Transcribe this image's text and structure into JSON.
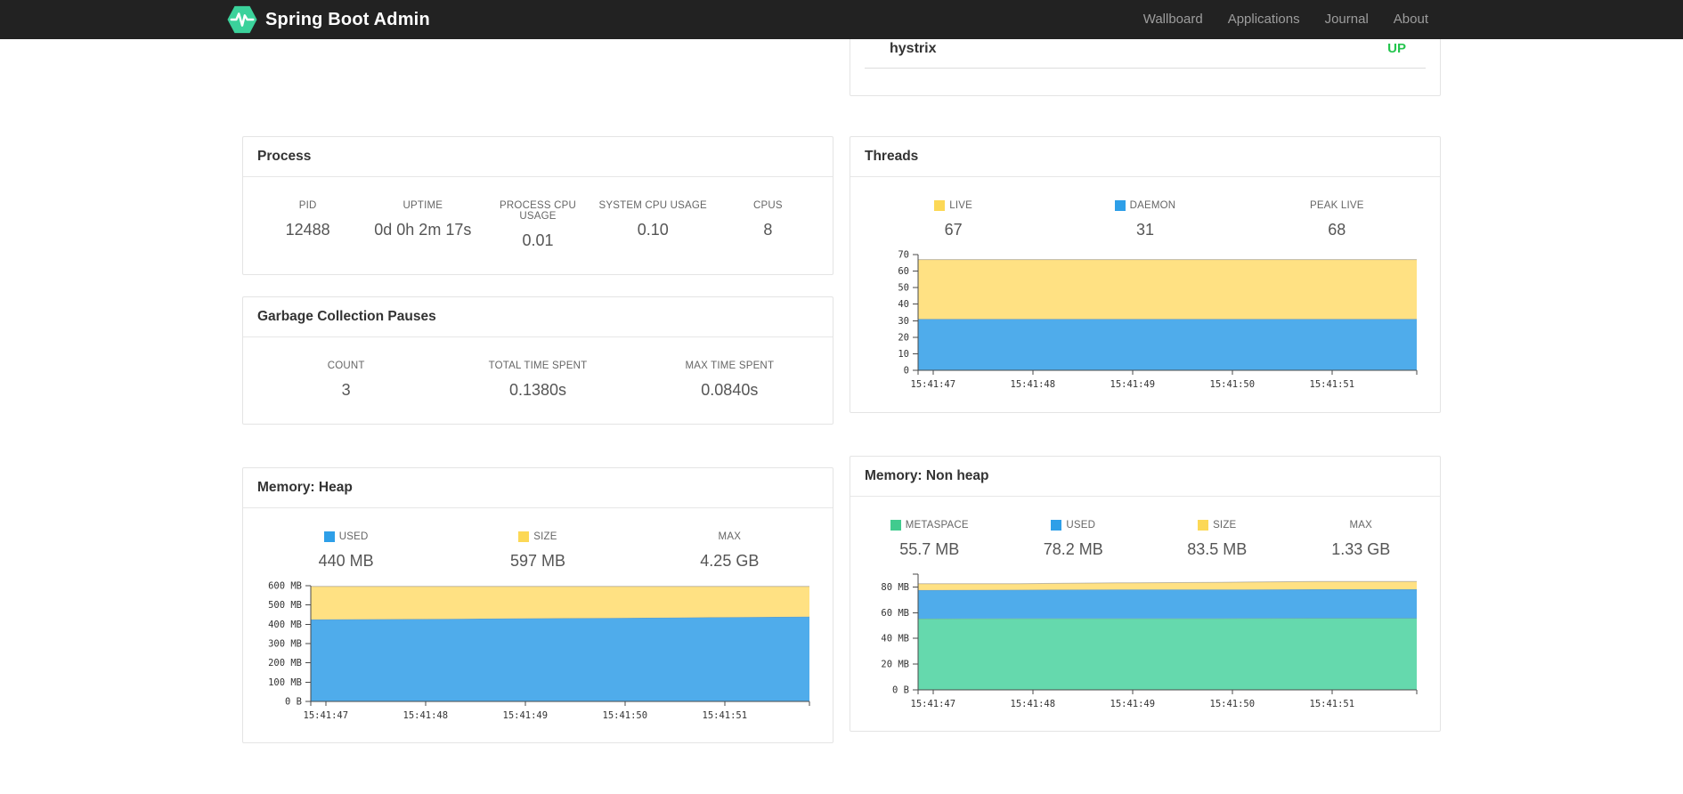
{
  "navbar": {
    "brand": "Spring Boot Admin",
    "logo_color": "#3bd29b",
    "links": [
      {
        "label": "Wallboard"
      },
      {
        "label": "Applications"
      },
      {
        "label": "Journal"
      },
      {
        "label": "About"
      }
    ]
  },
  "application_status": {
    "name": "hystrix",
    "status": "UP",
    "status_color": "#24c54e"
  },
  "panels": {
    "process": {
      "title": "Process",
      "metrics": [
        {
          "label": "PID",
          "value": "12488"
        },
        {
          "label": "UPTIME",
          "value": "0d 0h 2m 17s"
        },
        {
          "label": "PROCESS CPU USAGE",
          "value": "0.01"
        },
        {
          "label": "SYSTEM CPU USAGE",
          "value": "0.10"
        },
        {
          "label": "CPUS",
          "value": "8"
        }
      ]
    },
    "gc": {
      "title": "Garbage Collection Pauses",
      "metrics": [
        {
          "label": "COUNT",
          "value": "3"
        },
        {
          "label": "TOTAL TIME SPENT",
          "value": "0.1380s"
        },
        {
          "label": "MAX TIME SPENT",
          "value": "0.0840s"
        }
      ]
    },
    "threads": {
      "title": "Threads",
      "metrics": [
        {
          "label": "LIVE",
          "value": "67",
          "swatch": "#fcd856"
        },
        {
          "label": "DAEMON",
          "value": "31",
          "swatch": "#2e9fe8"
        },
        {
          "label": "PEAK LIVE",
          "value": "68"
        }
      ]
    },
    "heap": {
      "title": "Memory: Heap",
      "metrics": [
        {
          "label": "USED",
          "value": "440 MB",
          "swatch": "#2e9fe8"
        },
        {
          "label": "SIZE",
          "value": "597 MB",
          "swatch": "#fcd856"
        },
        {
          "label": "MAX",
          "value": "4.25 GB"
        }
      ]
    },
    "nonheap": {
      "title": "Memory: Non heap",
      "metrics": [
        {
          "label": "METASPACE",
          "value": "55.7 MB",
          "swatch": "#41cb8e"
        },
        {
          "label": "USED",
          "value": "78.2 MB",
          "swatch": "#2e9fe8"
        },
        {
          "label": "SIZE",
          "value": "83.5 MB",
          "swatch": "#fcd856"
        },
        {
          "label": "MAX",
          "value": "1.33 GB"
        }
      ]
    }
  },
  "chart_data": [
    {
      "id": "threads",
      "type": "area",
      "stacked": true,
      "title": "Threads",
      "legend": [
        {
          "name": "LIVE",
          "color": "#ffe183"
        },
        {
          "name": "DAEMON",
          "color": "#4faceb"
        }
      ],
      "x_ticks": [
        "15:41:47",
        "15:41:48",
        "15:41:49",
        "15:41:50",
        "15:41:51"
      ],
      "x_tick_fractions": [
        0.03,
        0.23,
        0.43,
        0.63,
        0.83
      ],
      "ylim": [
        0,
        70
      ],
      "yticks": [
        {
          "v": 0,
          "label": "0"
        },
        {
          "v": 10,
          "label": "10"
        },
        {
          "v": 20,
          "label": "20"
        },
        {
          "v": 30,
          "label": "30"
        },
        {
          "v": 40,
          "label": "40"
        },
        {
          "v": 50,
          "label": "50"
        },
        {
          "v": 60,
          "label": "60"
        },
        {
          "v": 70,
          "label": "70"
        }
      ],
      "series": [
        {
          "name": "DAEMON",
          "color": "#4faceb",
          "cumulative_top": [
            31,
            31,
            31,
            31,
            31,
            31
          ]
        },
        {
          "name": "LIVE",
          "color": "#ffe183",
          "cumulative_top": [
            67,
            67,
            67,
            67,
            67,
            67
          ]
        }
      ]
    },
    {
      "id": "heap",
      "type": "area",
      "stacked": true,
      "title": "Memory: Heap",
      "legend": [
        {
          "name": "USED",
          "color": "#4faceb"
        },
        {
          "name": "SIZE",
          "color": "#ffe183"
        }
      ],
      "x_ticks": [
        "15:41:47",
        "15:41:48",
        "15:41:49",
        "15:41:50",
        "15:41:51"
      ],
      "x_tick_fractions": [
        0.03,
        0.23,
        0.43,
        0.63,
        0.83
      ],
      "ylim": [
        0,
        600
      ],
      "yticks": [
        {
          "v": 0,
          "label": "0 B"
        },
        {
          "v": 100,
          "label": "100 MB"
        },
        {
          "v": 200,
          "label": "200 MB"
        },
        {
          "v": 300,
          "label": "300 MB"
        },
        {
          "v": 400,
          "label": "400 MB"
        },
        {
          "v": 500,
          "label": "500 MB"
        },
        {
          "v": 600,
          "label": "600 MB"
        }
      ],
      "series": [
        {
          "name": "USED (MB)",
          "color": "#4faceb",
          "cumulative_top": [
            425,
            427,
            430,
            433,
            436,
            440
          ]
        },
        {
          "name": "SIZE (MB)",
          "color": "#ffe183",
          "cumulative_top": [
            597,
            597,
            597,
            597,
            597,
            597
          ]
        }
      ]
    },
    {
      "id": "nonheap",
      "type": "area",
      "stacked": true,
      "title": "Memory: Non heap",
      "legend": [
        {
          "name": "METASPACE",
          "color": "#65d9ad"
        },
        {
          "name": "USED",
          "color": "#4faceb"
        },
        {
          "name": "SIZE",
          "color": "#ffe183"
        }
      ],
      "x_ticks": [
        "15:41:47",
        "15:41:48",
        "15:41:49",
        "15:41:50",
        "15:41:51"
      ],
      "x_tick_fractions": [
        0.03,
        0.23,
        0.43,
        0.63,
        0.83
      ],
      "ylim": [
        0,
        90
      ],
      "yticks": [
        {
          "v": 0,
          "label": "0 B"
        },
        {
          "v": 20,
          "label": "20 MB"
        },
        {
          "v": 40,
          "label": "40 MB"
        },
        {
          "v": 60,
          "label": "60 MB"
        },
        {
          "v": 80,
          "label": "80 MB"
        }
      ],
      "series": [
        {
          "name": "METASPACE (MB)",
          "color": "#65d9ad",
          "cumulative_top": [
            55.4,
            55.5,
            55.6,
            55.6,
            55.7,
            55.7
          ]
        },
        {
          "name": "USED (MB)",
          "color": "#4faceb",
          "cumulative_top": [
            77.6,
            77.8,
            78.0,
            78.0,
            78.2,
            78.2
          ]
        },
        {
          "name": "SIZE (MB)",
          "color": "#ffe183",
          "cumulative_top": [
            82.6,
            82.6,
            83.2,
            83.6,
            84.3,
            84.3
          ]
        }
      ]
    }
  ]
}
